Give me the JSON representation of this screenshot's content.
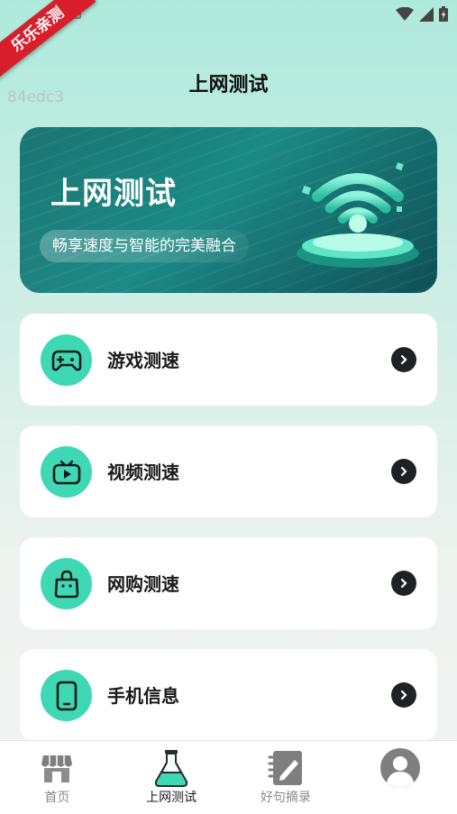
{
  "ribbon": "乐乐亲测",
  "watermark": "84edc3",
  "page_title": "上网测试",
  "banner": {
    "title": "上网测试",
    "subtitle": "畅享速度与智能的完美融合"
  },
  "items": [
    {
      "label": "游戏测速",
      "icon": "gamepad-icon"
    },
    {
      "label": "视频测速",
      "icon": "tv-play-icon"
    },
    {
      "label": "网购测速",
      "icon": "shopping-bag-icon"
    },
    {
      "label": "手机信息",
      "icon": "phone-icon"
    }
  ],
  "nav": [
    {
      "label": "首页",
      "icon": "store-icon",
      "active": false
    },
    {
      "label": "上网测试",
      "icon": "flask-icon",
      "active": true
    },
    {
      "label": "好句摘录",
      "icon": "notebook-pen-icon",
      "active": false
    },
    {
      "label": "",
      "icon": "avatar-icon",
      "active": false
    }
  ],
  "colors": {
    "accent": "#3fd8b4",
    "ribbon": "#d81e2a",
    "banner": "#1b8a85"
  }
}
